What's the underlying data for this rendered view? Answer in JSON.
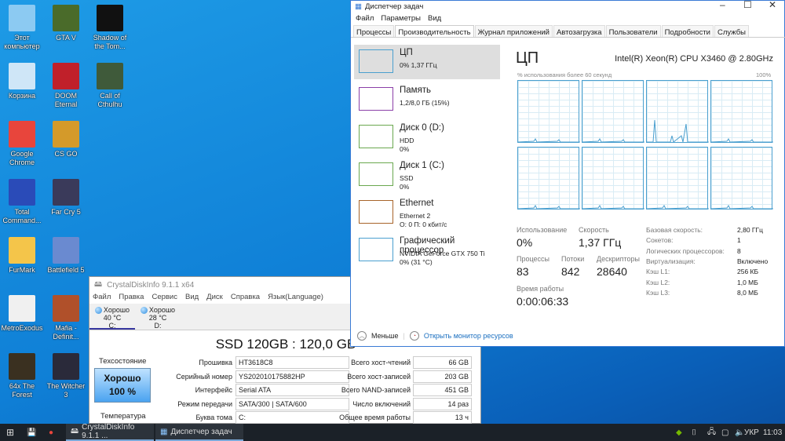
{
  "desktop": {
    "icons": [
      {
        "label": "Этот компьютер",
        "color": "#8ccaf2"
      },
      {
        "label": "GTA V",
        "color": "#4a6b2a"
      },
      {
        "label": "Shadow of the Tom...",
        "color": "#111111"
      },
      {
        "label": "Корзина",
        "color": "#cfe6f7"
      },
      {
        "label": "DOOM Eternal",
        "color": "#c0202a"
      },
      {
        "label": "Call of Cthulhu",
        "color": "#3f5a3a"
      },
      {
        "label": "Google Chrome",
        "color": "#e8453c"
      },
      {
        "label": "CS GO",
        "color": "#d49a2a"
      },
      null,
      {
        "label": "Total Command...",
        "color": "#2a4bb8"
      },
      {
        "label": "Far Cry 5",
        "color": "#3a3a5a"
      },
      null,
      {
        "label": "FurMark",
        "color": "#f4c54a"
      },
      {
        "label": "Battlefield 5",
        "color": "#6a8ad0"
      },
      null,
      {
        "label": "MetroExodus",
        "color": "#f0f0f0"
      },
      {
        "label": "Mafia - Definit...",
        "color": "#b0502a"
      },
      null,
      {
        "label": "64x The Forest",
        "color": "#3a3020"
      },
      {
        "label": "The Witcher 3",
        "color": "#2a2a3a"
      },
      null
    ]
  },
  "cdi": {
    "title": "CrystalDiskInfo 9.1.1 x64",
    "menu": [
      "Файл",
      "Правка",
      "Сервис",
      "Вид",
      "Диск",
      "Справка",
      "Язык(Language)"
    ],
    "disks": [
      {
        "status": "Хорошо",
        "temp": "40 °C",
        "letter": "C:"
      },
      {
        "status": "Хорошо",
        "temp": "28 °C",
        "letter": "D:"
      }
    ],
    "model": "SSD 120GB : 120,0 GB",
    "health_label": "Техсостояние",
    "health_status": "Хорошо",
    "health_pct": "100 %",
    "temp_label": "Температура",
    "rows": [
      {
        "l1": "Прошивка",
        "v1": "HT3618C8",
        "l2": "Всего хост-чтений",
        "v2": "66 GB"
      },
      {
        "l1": "Серийный номер",
        "v1": "YS202010175882HP",
        "l2": "Всего хост-записей",
        "v2": "203 GB"
      },
      {
        "l1": "Интерфейс",
        "v1": "Serial ATA",
        "l2": "Всего NAND-записей",
        "v2": "451 GB"
      },
      {
        "l1": "Режим передачи",
        "v1": "SATA/300 | SATA/600",
        "l2": "Число включений",
        "v2": "14 раз"
      },
      {
        "l1": "Буква тома",
        "v1": "C:",
        "l2": "Общее время работы",
        "v2": "13 ч"
      }
    ]
  },
  "tm": {
    "title": "Диспетчер задач",
    "menu": [
      "Файл",
      "Параметры",
      "Вид"
    ],
    "tabs": [
      "Процессы",
      "Производительность",
      "Журнал приложений",
      "Автозагрузка",
      "Пользователи",
      "Подробности",
      "Службы"
    ],
    "sidebar": [
      {
        "name": "ЦП",
        "l1": "0% 1,37 ГГц",
        "l2": "",
        "color": "#4a9fcf"
      },
      {
        "name": "Память",
        "l1": "1,2/8,0 ГБ (15%)",
        "l2": "",
        "color": "#8b3fa8"
      },
      {
        "name": "Диск 0 (D:)",
        "l1": "HDD",
        "l2": "0%",
        "color": "#6aa84f"
      },
      {
        "name": "Диск 1 (C:)",
        "l1": "SSD",
        "l2": "0%",
        "color": "#6aa84f"
      },
      {
        "name": "Ethernet",
        "l1": "Ethernet 2",
        "l2": "О: 0 П: 0 кбит/с",
        "color": "#a8642a"
      },
      {
        "name": "Графический процессор",
        "l1": "NVIDIA GeForce GTX 750 Ti",
        "l2": "0% (31 °C)",
        "color": "#4a9fcf"
      }
    ],
    "cpu_title": "ЦП",
    "cpu_name": "Intel(R) Xeon(R) CPU X3460 @ 2.80GHz",
    "graph_label": "% использования более 60 секунд",
    "graph_max": "100%",
    "stats": {
      "usage_label": "Использование",
      "usage": "0%",
      "speed_label": "Скорость",
      "speed": "1,37 ГГц",
      "proc_label": "Процессы",
      "proc": "83",
      "threads_label": "Потоки",
      "threads": "842",
      "handles_label": "Дескрипторы",
      "handles": "28640",
      "uptime_label": "Время работы",
      "uptime": "0:00:06:33"
    },
    "info": [
      [
        "Базовая скорость:",
        "2,80 ГГц"
      ],
      [
        "Сокетов:",
        "1"
      ],
      [
        "Логических процессоров:",
        "8"
      ],
      [
        "Виртуализация:",
        "Включено"
      ],
      [
        "Кэш L1:",
        "256 КБ"
      ],
      [
        "Кэш L2:",
        "1,0 МБ"
      ],
      [
        "Кэш L3:",
        "8,0 МБ"
      ]
    ],
    "less": "Меньше",
    "monitor": "Открыть монитор ресурсов"
  },
  "taskbar": {
    "apps": [
      "CrystalDiskInfo 9.1.1 ...",
      "Диспетчер задач"
    ],
    "lang": "УКР",
    "time": "11:03"
  }
}
